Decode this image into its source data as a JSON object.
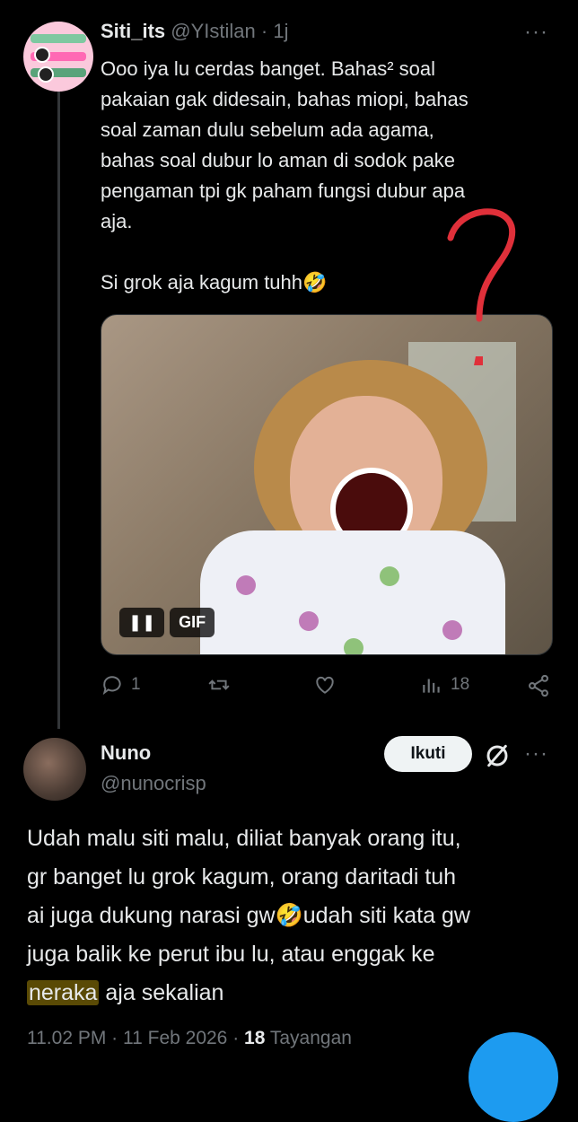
{
  "tweet1": {
    "display_name": "Siti_its",
    "handle": "@YIstilan",
    "time": "1j",
    "more": "···",
    "text": "Ooo iya lu cerdas banget. Bahas² soal\npakaian gak didesain, bahas miopi, bahas\nsoal zaman dulu sebelum ada agama,\nbahas soal dubur lo aman di sodok pake\npengaman tpi gk paham fungsi dubur apa\naja.\n\nSi grok aja kagum tuhh🤣",
    "gif_badge": "GIF",
    "pause_glyph": "❚❚",
    "actions": {
      "reply_count": "1",
      "views_count": "18"
    },
    "icons": [
      "reply-icon",
      "retweet-icon",
      "like-icon",
      "views-icon",
      "share-icon"
    ]
  },
  "tweet2": {
    "display_name": "Nuno",
    "handle": "@nunocrisp",
    "follow_label": "Ikuti",
    "more": "···",
    "text_before": "Udah malu siti malu, diliat banyak orang itu,\ngr banget lu grok kagum, orang daritadi tuh\nai juga dukung narasi gw🤣udah siti kata gw\njuga balik ke perut ibu lu, atau enggak ke\n",
    "highlighted": "neraka",
    "text_after": " aja sekalian",
    "meta_time": "11.02 PM · 11 Feb 2026 · ",
    "meta_views": "18",
    "meta_views_label": " Tayangan"
  },
  "colors": {
    "background": "#000000",
    "text": "#e7e9ea",
    "secondary": "#71767b",
    "annotation": "#e0303a",
    "accent": "#1d9bf0"
  }
}
